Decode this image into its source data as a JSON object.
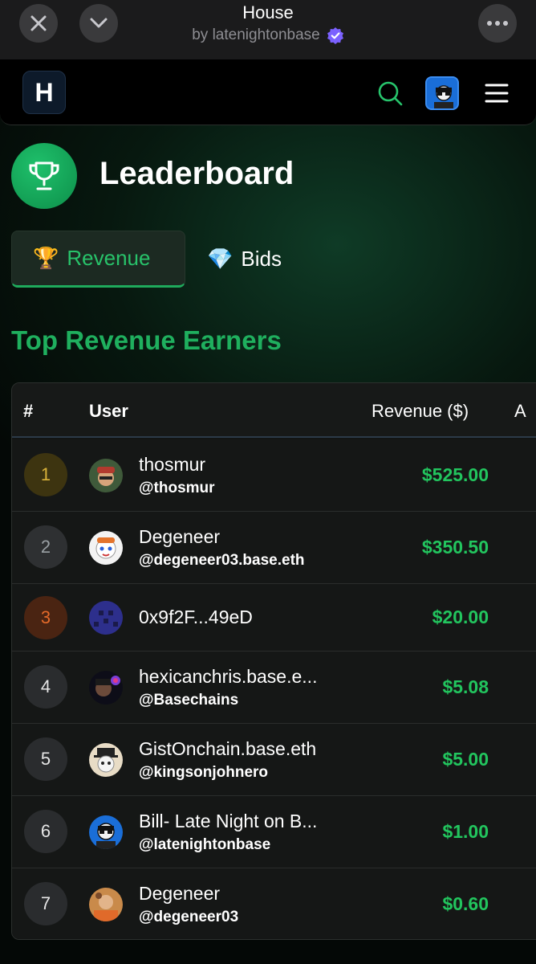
{
  "topbar": {
    "title": "House",
    "subtitle": "by latenightonbase",
    "close_icon": "close-icon",
    "collapse_icon": "chevron-down-icon",
    "more_icon": "more-icon"
  },
  "header": {
    "logo_letter": "H",
    "search_icon": "search-icon",
    "menu_icon": "hamburger-icon"
  },
  "page": {
    "title": "Leaderboard",
    "trophy_icon": "trophy-icon"
  },
  "tabs": [
    {
      "emoji": "🏆",
      "label": "Revenue",
      "active": true
    },
    {
      "emoji": "💎",
      "label": "Bids",
      "active": false
    }
  ],
  "section_title": "Top Revenue Earners",
  "table": {
    "headers": {
      "rank": "#",
      "user": "User",
      "revenue": "Revenue ($)",
      "extra": "A"
    },
    "rows": [
      {
        "rank": "1",
        "name": "thosmur",
        "handle": "@thosmur",
        "revenue": "$525.00"
      },
      {
        "rank": "2",
        "name": "Degeneer",
        "handle": "@degeneer03.base.eth",
        "revenue": "$350.50"
      },
      {
        "rank": "3",
        "name": "0x9f2F...49eD",
        "handle": "",
        "revenue": "$20.00"
      },
      {
        "rank": "4",
        "name": "hexicanchris.base.e...",
        "handle": "@Basechains",
        "revenue": "$5.08"
      },
      {
        "rank": "5",
        "name": "GistOnchain.base.eth",
        "handle": "@kingsonjohnero",
        "revenue": "$5.00"
      },
      {
        "rank": "6",
        "name": "Bill- Late Night on B...",
        "handle": "@latenightonbase",
        "revenue": "$1.00"
      },
      {
        "rank": "7",
        "name": "Degeneer",
        "handle": "@degeneer03",
        "revenue": "$0.60"
      }
    ]
  },
  "colors": {
    "accent_green": "#22c55e",
    "verified_purple": "#7b61ff",
    "rank_gold": "#d9b23a",
    "rank_bronze": "#e46a2a"
  }
}
